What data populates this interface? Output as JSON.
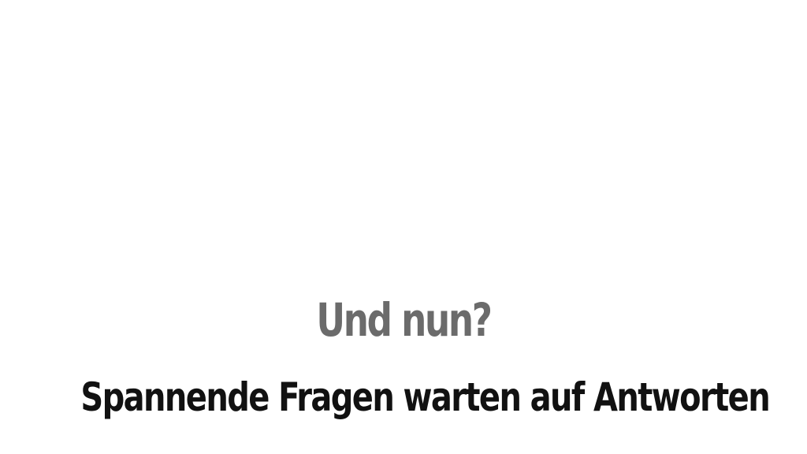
{
  "slide": {
    "heading": "Und nun?",
    "subheading": "Spannende Fragen warten auf Antworten",
    "heading_color": "#6b6b6b",
    "subheading_color": "#111111",
    "background_color": "#ffffff"
  }
}
